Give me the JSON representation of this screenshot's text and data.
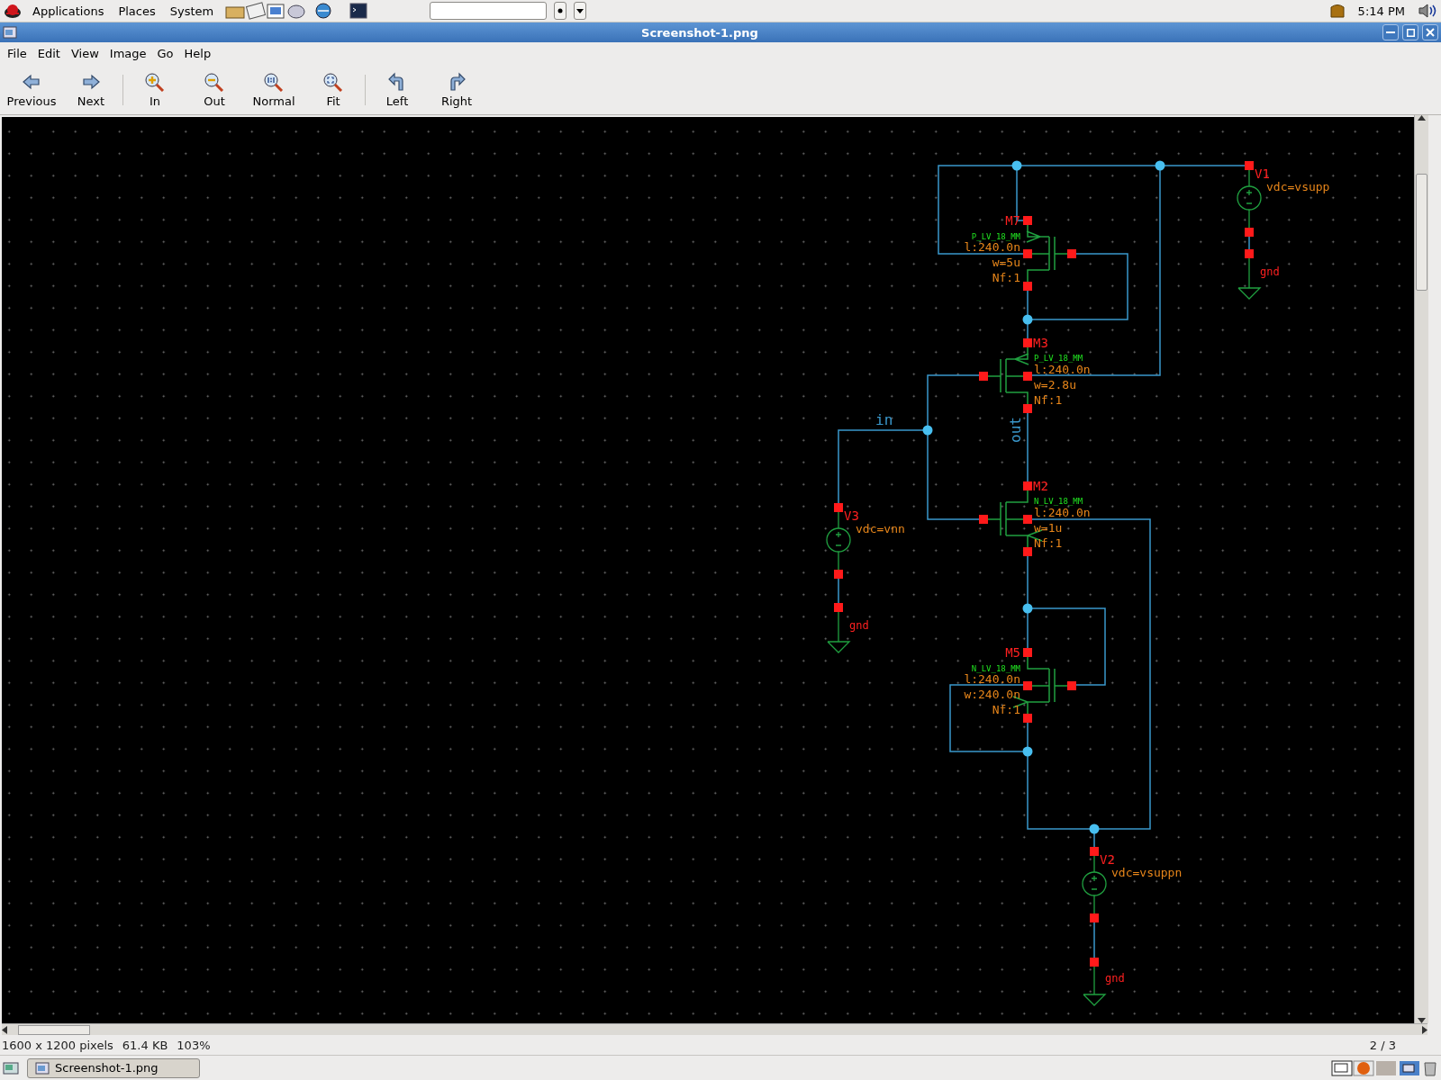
{
  "top_panel": {
    "menus": [
      "Applications",
      "Places",
      "System"
    ],
    "clock": "5:14 PM"
  },
  "window": {
    "title": "Screenshot-1.png"
  },
  "menu_bar": [
    "File",
    "Edit",
    "View",
    "Image",
    "Go",
    "Help"
  ],
  "toolbar": {
    "groups": [
      [
        {
          "label": "Previous",
          "kind": "back"
        },
        {
          "label": "Next",
          "kind": "forward"
        }
      ],
      [
        {
          "label": "In",
          "kind": "zoomin"
        },
        {
          "label": "Out",
          "kind": "zoomout"
        },
        {
          "label": "Normal",
          "kind": "normal"
        },
        {
          "label": "Fit",
          "kind": "fit"
        }
      ],
      [
        {
          "label": "Left",
          "kind": "rotleft"
        },
        {
          "label": "Right",
          "kind": "rotright"
        }
      ]
    ]
  },
  "schematic": {
    "transistors": [
      {
        "kind": "pmos",
        "name": "M7",
        "model": "P_LV_18_MM",
        "params": [
          "l:240.0n",
          "w=5u",
          "Nf:1"
        ]
      },
      {
        "kind": "pmos",
        "name": "M3",
        "model": "P_LV_18_MM",
        "params": [
          "l:240.0n",
          "w=2.8u",
          "Nf:1"
        ]
      },
      {
        "kind": "nmos",
        "name": "M2",
        "model": "N_LV_18_MM",
        "params": [
          "l:240.0n",
          "w=1u",
          "Nf:1"
        ]
      },
      {
        "kind": "nmos",
        "name": "M5",
        "model": "N_LV_18_MM",
        "params": [
          "l:240.0n",
          "w:240.0n",
          "Nf:1"
        ]
      }
    ],
    "sources": [
      {
        "name": "V1",
        "value": "vdc=vsupp",
        "ground": "gnd"
      },
      {
        "name": "V3",
        "value": "vdc=vnn",
        "ground": "gnd"
      },
      {
        "name": "V2",
        "value": "vdc=vsuppn",
        "ground": "gnd"
      }
    ],
    "net_labels": [
      "in",
      "out"
    ]
  },
  "status_bar": {
    "size": "1600 x 1200 pixels",
    "file_size": "61.4 KB",
    "zoom": "103%",
    "position": "2 / 3"
  },
  "taskbar": {
    "tasks": [
      "Screenshot-1.png"
    ]
  }
}
